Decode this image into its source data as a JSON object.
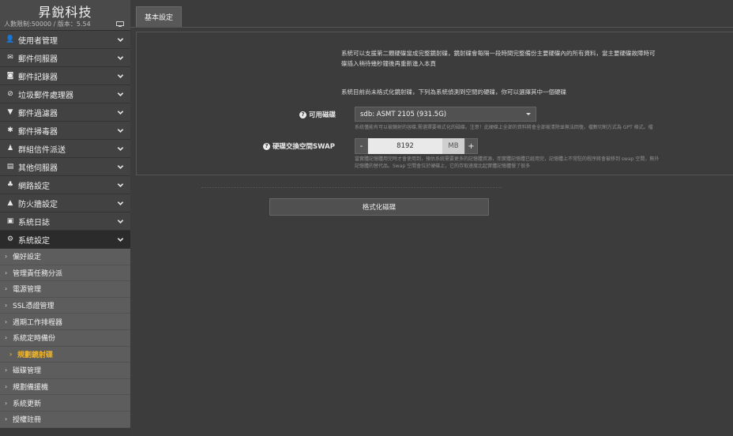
{
  "brand": {
    "title": "昇銳科技",
    "info": "人數限制:50000 / 版本：5.54"
  },
  "sidebar": {
    "items": [
      {
        "label": "使用者管理",
        "icon": "user-icon",
        "glyph": "👤"
      },
      {
        "label": "郵件伺服器",
        "icon": "envelope-icon",
        "glyph": "✉"
      },
      {
        "label": "郵件記錄器",
        "icon": "camera-icon",
        "glyph": "◙"
      },
      {
        "label": "垃圾郵件處理器",
        "icon": "ban-icon",
        "glyph": "⊘"
      },
      {
        "label": "郵件過濾器",
        "icon": "filter-icon",
        "glyph": "▼"
      },
      {
        "label": "郵件掃毒器",
        "icon": "bug-icon",
        "glyph": "✱"
      },
      {
        "label": "群組信件派送",
        "icon": "group-icon",
        "glyph": "♟"
      },
      {
        "label": "其他伺服器",
        "icon": "server-icon",
        "glyph": "▤"
      },
      {
        "label": "網路設定",
        "icon": "sitemap-icon",
        "glyph": "♣"
      },
      {
        "label": "防火牆設定",
        "icon": "fire-truck-icon",
        "glyph": "▲"
      },
      {
        "label": "系統日誌",
        "icon": "film-icon",
        "glyph": "▣"
      },
      {
        "label": "系統設定",
        "icon": "cogs-icon",
        "glyph": "⚙"
      }
    ],
    "subitems": [
      "偏好設定",
      "管理責任務分派",
      "電源管理",
      "SSL憑證管理",
      "週期工作排程器",
      "系統定時備份",
      "規劃鏡射碟",
      "磁碟管理",
      "規劃備援機",
      "系統更新",
      "授權註冊"
    ]
  },
  "tabs": {
    "basic": "基本設定"
  },
  "content": {
    "desc_line1": "系統可以支援第二顆硬碟當成完整鏡射碟，鏡射碟會每隔一段時間完整備份主要硬碟內的所有資料，當主要硬碟故障時可",
    "desc_line2": "碟插入稍待幾秒鐘後再重新進入本頁",
    "desc_line3": "系統目前尚未格式化鏡射碟，下列為系統偵測到空閒的硬碟，你可以選擇其中一個硬碟",
    "disk_label": "可用磁碟",
    "disk_value": "sdb: ASMT 2105 (931.5G)",
    "disk_hint": "系統僅能有可以被鏡射的容碟,需選擇要格式化的磁碟。注意！此硬碟上全部的資料將會全部被清除並無法回復。檔數切割方式為 GPT 格式。檔",
    "swap_label": "硬碟交換空間SWAP",
    "swap_minus": "-",
    "swap_value": "8192",
    "swap_unit": "MB",
    "swap_plus": "+",
    "swap_hint1": "當實體記憶體用完時才會使用到，預估系統需要更多的記憶體資源，而實體記憶體已經用完，記憶體上不常駐的程序將會被移到 swap 空間，無外",
    "swap_hint2": "記憶體的替代品。Swap 空間會位於硬碟上，它的存取速度比起實體記憶體慢了很多",
    "format_button": "格式化磁碟"
  },
  "colors": {
    "sidebar_bg": "#424242",
    "submenu_bg": "#5d5d5d",
    "active_item": "#f0b429",
    "main_bg": "#3c3c3c"
  }
}
